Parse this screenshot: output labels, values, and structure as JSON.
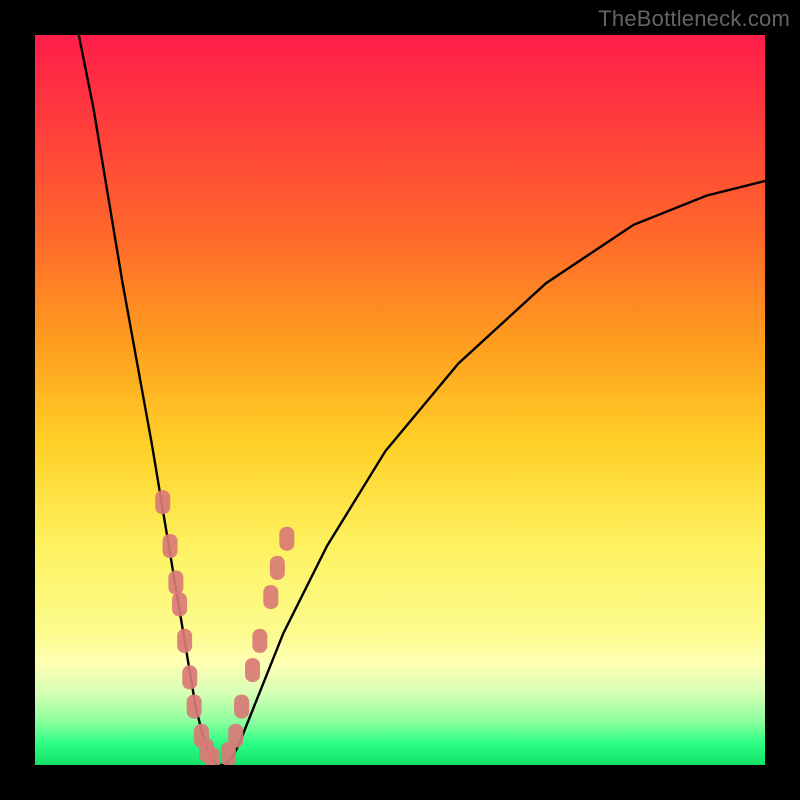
{
  "watermark": "TheBottleneck.com",
  "colors": {
    "frame": "#000000",
    "curve": "#000000",
    "marker_fill": "#d97a76",
    "marker_stroke": "#d97a76",
    "gradient_top": "#ff1e4a",
    "gradient_bottom": "#14e268"
  },
  "chart_data": {
    "type": "line",
    "title": "",
    "xlabel": "",
    "ylabel": "",
    "xlim": [
      0,
      100
    ],
    "ylim": [
      0,
      100
    ],
    "grid": false,
    "legend": "none",
    "annotations": [
      "TheBottleneck.com"
    ],
    "series": [
      {
        "name": "bottleneck-curve",
        "x": [
          6,
          8,
          10,
          12,
          14,
          16,
          18,
          19,
          20,
          21,
          22,
          23,
          24,
          25,
          26,
          27,
          28,
          30,
          34,
          40,
          48,
          58,
          70,
          82,
          92,
          100
        ],
        "values": [
          100,
          90,
          78,
          66,
          55,
          44,
          32,
          26,
          20,
          14,
          8,
          4,
          1,
          0,
          0,
          1,
          3,
          8,
          18,
          30,
          43,
          55,
          66,
          74,
          78,
          80
        ]
      },
      {
        "name": "data-markers-left",
        "x": [
          17.5,
          18.5,
          19.3,
          19.8,
          20.5,
          21.2,
          21.8,
          22.8,
          23.5,
          24.3
        ],
        "values": [
          36,
          30,
          25,
          22,
          17,
          12,
          8,
          4,
          2,
          0.8
        ]
      },
      {
        "name": "data-markers-right",
        "x": [
          26.5,
          27.5,
          28.3,
          29.8,
          30.8,
          32.3,
          33.2,
          34.5
        ],
        "values": [
          1.5,
          4,
          8,
          13,
          17,
          23,
          27,
          31
        ]
      }
    ]
  }
}
